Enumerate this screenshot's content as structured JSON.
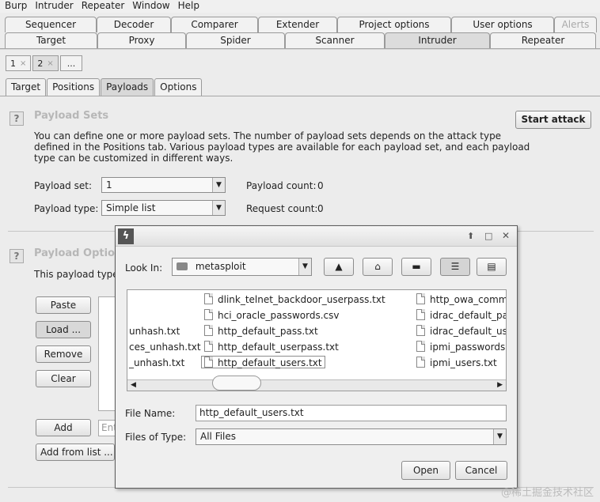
{
  "menu": [
    "Burp",
    "Intruder",
    "Repeater",
    "Window",
    "Help"
  ],
  "top_tabs_row1": [
    "Sequencer",
    "Decoder",
    "Comparer",
    "Extender",
    "Project options",
    "User options",
    "Alerts"
  ],
  "top_tabs_row2": [
    "Target",
    "Proxy",
    "Spider",
    "Scanner",
    "Intruder",
    "Repeater"
  ],
  "number_tabs": [
    "1",
    "2",
    "..."
  ],
  "number_tab_close": "×",
  "sub_tabs": [
    "Target",
    "Positions",
    "Payloads",
    "Options"
  ],
  "payload_sets": {
    "title": "Payload Sets",
    "start_attack": "Start attack",
    "description": [
      "You can define one or more payload sets. The number of payload sets depends on the attack type",
      "defined in the Positions tab. Various payload types are available for each payload set, and each payload",
      "type can be customized in different ways."
    ],
    "payload_set_label": "Payload set:",
    "payload_set_value": "1",
    "payload_count_label": "Payload count:",
    "payload_count_value": "0",
    "payload_type_label": "Payload type:",
    "payload_type_value": "Simple list",
    "request_count_label": "Request count:",
    "request_count_value": "0"
  },
  "payload_options": {
    "title": "Payload Optio",
    "description": "This payload type",
    "paste": "Paste",
    "load": "Load ...",
    "remove": "Remove",
    "clear": "Clear",
    "add": "Add",
    "add_placeholder": "Ent",
    "add_from_list": "Add from list ..."
  },
  "dialog": {
    "look_in_label": "Look In:",
    "look_in_value": "metasploit",
    "file_name_label": "File Name:",
    "file_name_value": "http_default_users.txt",
    "files_of_type_label": "Files of Type:",
    "files_of_type_value": "All Files",
    "open": "Open",
    "cancel": "Cancel",
    "col0": [
      "unhash.txt",
      "ces_unhash.txt",
      "_unhash.txt"
    ],
    "col1": [
      "dlink_telnet_backdoor_userpass.txt",
      "hci_oracle_passwords.csv",
      "http_default_pass.txt",
      "http_default_userpass.txt",
      "http_default_users.txt"
    ],
    "col2": [
      "http_owa_common",
      "idrac_default_pas",
      "idrac_default_use",
      "ipmi_passwords.t",
      "ipmi_users.txt"
    ]
  },
  "watermark": "@稀土掘金技术社区"
}
